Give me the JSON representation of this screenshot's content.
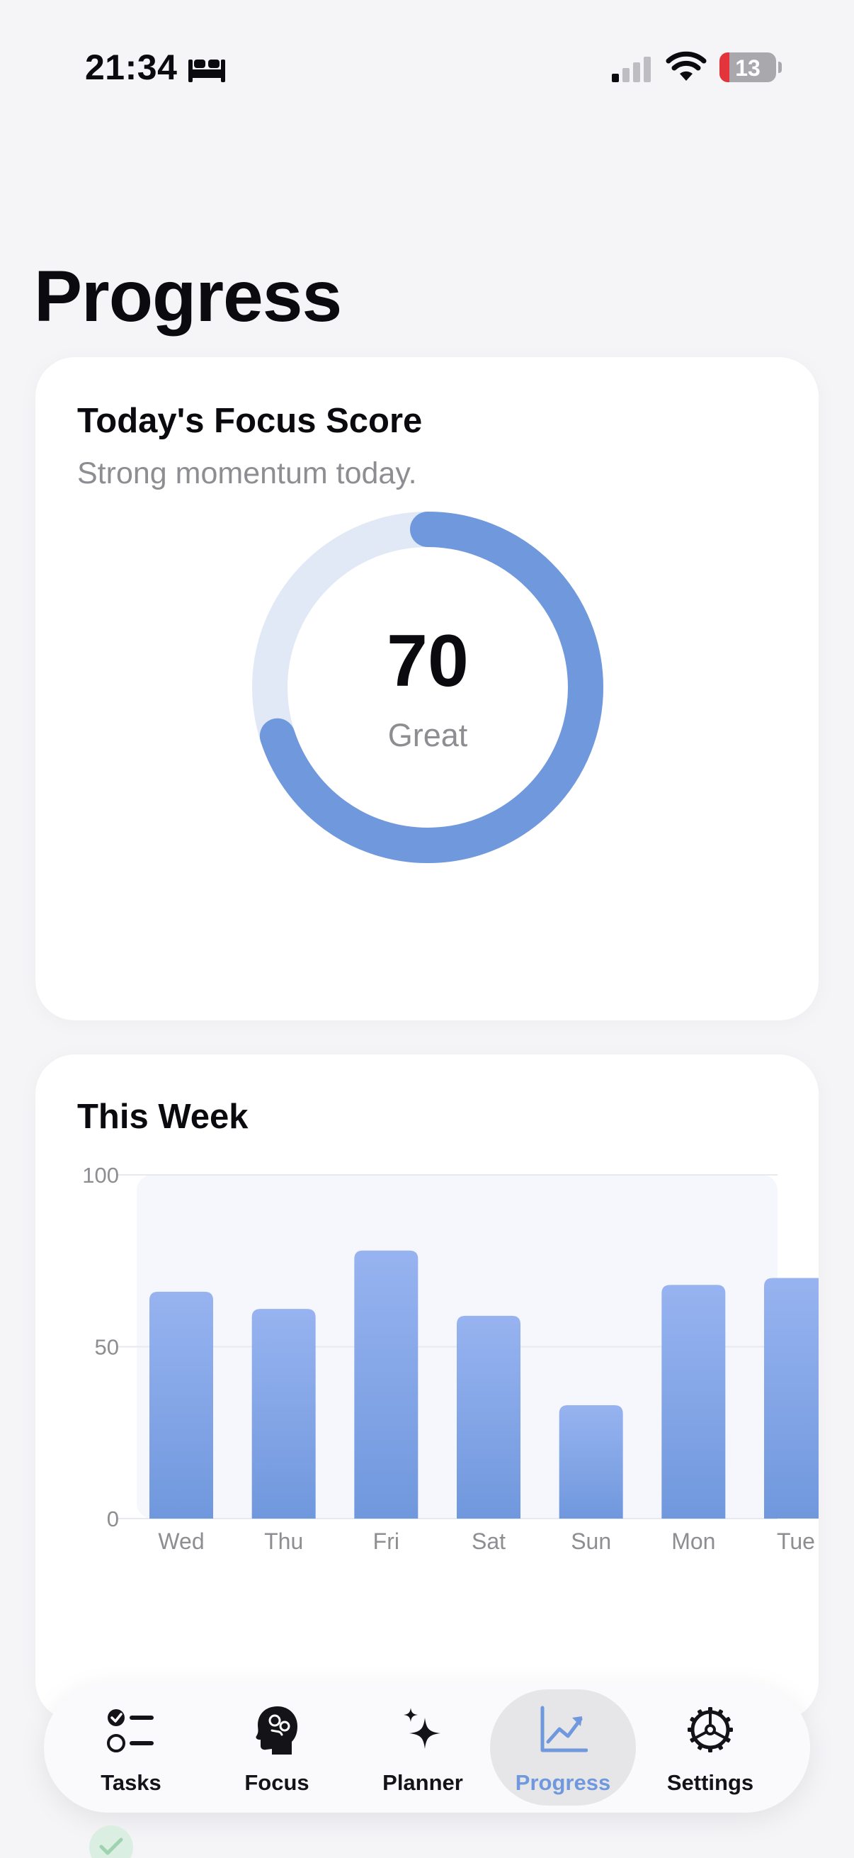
{
  "status_bar": {
    "time": "21:34",
    "battery": "13",
    "icons": [
      "bed-icon",
      "cellular-signal-icon",
      "wifi-icon",
      "battery-icon"
    ]
  },
  "page": {
    "title": "Progress"
  },
  "focus_card": {
    "title": "Today's Focus Score",
    "subtitle": "Strong momentum today.",
    "score": "70",
    "score_fraction": 0.7,
    "rating": "Great",
    "ring_color": "#7098dd",
    "track_color": "#e1e8f6"
  },
  "week_card": {
    "title": "This Week"
  },
  "chart_data": {
    "type": "bar",
    "categories": [
      "Wed",
      "Thu",
      "Fri",
      "Sat",
      "Sun",
      "Mon",
      "Tue"
    ],
    "values": [
      66,
      61,
      78,
      59,
      33,
      68,
      70
    ],
    "ylim": [
      0,
      100
    ],
    "yticks": [
      "100",
      "50",
      "0"
    ],
    "grid": true,
    "bar_color_top": "#97b3f0",
    "bar_color_bottom": "#7098dd"
  },
  "tab_bar": {
    "items": [
      {
        "label": "Tasks",
        "icon": "checklist-icon",
        "active": false
      },
      {
        "label": "Focus",
        "icon": "brain-head-icon",
        "active": false
      },
      {
        "label": "Planner",
        "icon": "sparkles-icon",
        "active": false
      },
      {
        "label": "Progress",
        "icon": "chart-trend-icon",
        "active": true
      },
      {
        "label": "Settings",
        "icon": "gear-icon",
        "active": false
      }
    ],
    "active_color": "#7098dd"
  }
}
